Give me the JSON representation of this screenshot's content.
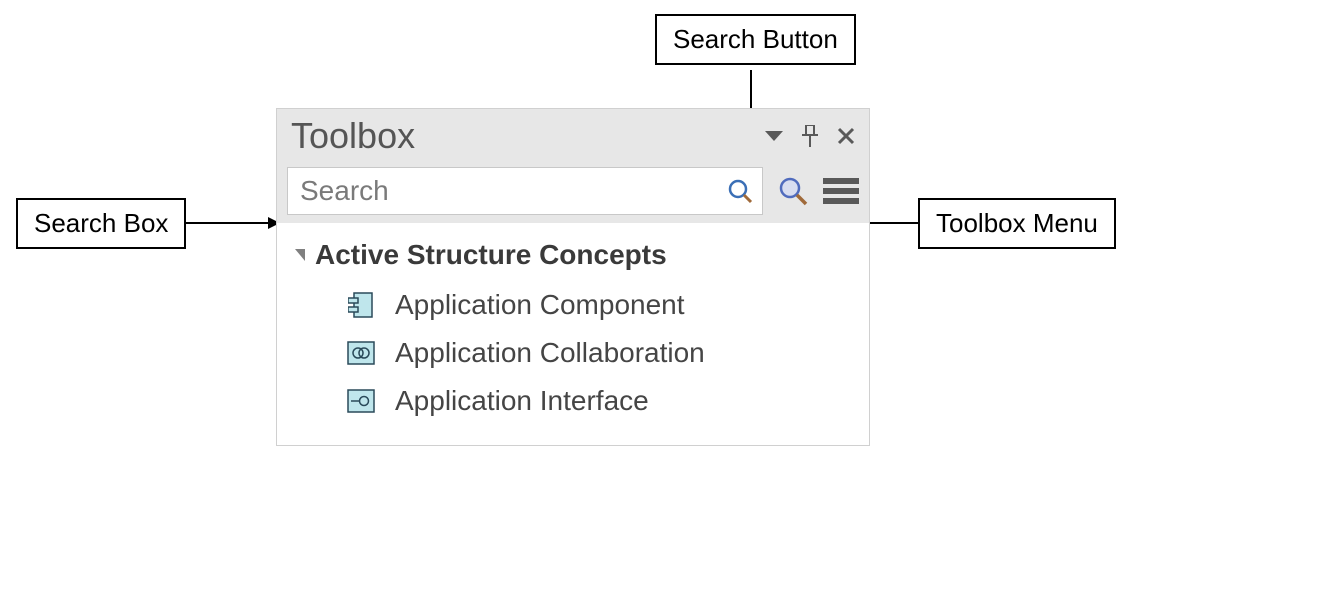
{
  "annotations": {
    "search_box": "Search Box",
    "search_button": "Search Button",
    "toolbox_menu": "Toolbox Menu"
  },
  "panel": {
    "title": "Toolbox",
    "search": {
      "placeholder": "Search"
    },
    "group": {
      "title": "Active Structure Concepts"
    },
    "items": [
      {
        "label": "Application Component",
        "icon": "component-icon"
      },
      {
        "label": "Application Collaboration",
        "icon": "collaboration-icon"
      },
      {
        "label": "Application Interface",
        "icon": "interface-icon"
      }
    ]
  }
}
